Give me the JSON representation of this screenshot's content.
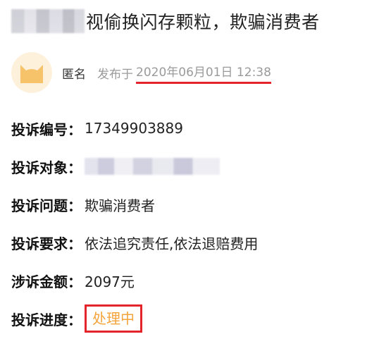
{
  "post": {
    "title_visible": "视偷换闪存颗粒，欺骗消费者",
    "author": "匿名",
    "published_prefix": "发布于",
    "published_datetime": "2020年06月01日 12:38"
  },
  "details": [
    {
      "label": "投诉编号",
      "colon": "：",
      "value": "17349903889"
    },
    {
      "label": "投诉对象",
      "colon": "：",
      "value": ""
    },
    {
      "label": "投诉问题",
      "colon": "：",
      "value": "欺骗消费者"
    },
    {
      "label": "投诉要求",
      "colon": "：",
      "value": "依法追究责任,依法退赔费用"
    },
    {
      "label": "涉诉金额",
      "colon": "：",
      "value": "2097元"
    },
    {
      "label": "投诉进度",
      "colon": "：",
      "value": "处理中"
    }
  ],
  "colors": {
    "highlight_red": "#e4242b",
    "status_orange": "#f3a43a",
    "muted_gray": "#9a9a9a",
    "avatar_bg": "#fdf1dc",
    "avatar_fg": "#f7c36a"
  },
  "icons": {
    "avatar": "cat-avatar-icon"
  }
}
